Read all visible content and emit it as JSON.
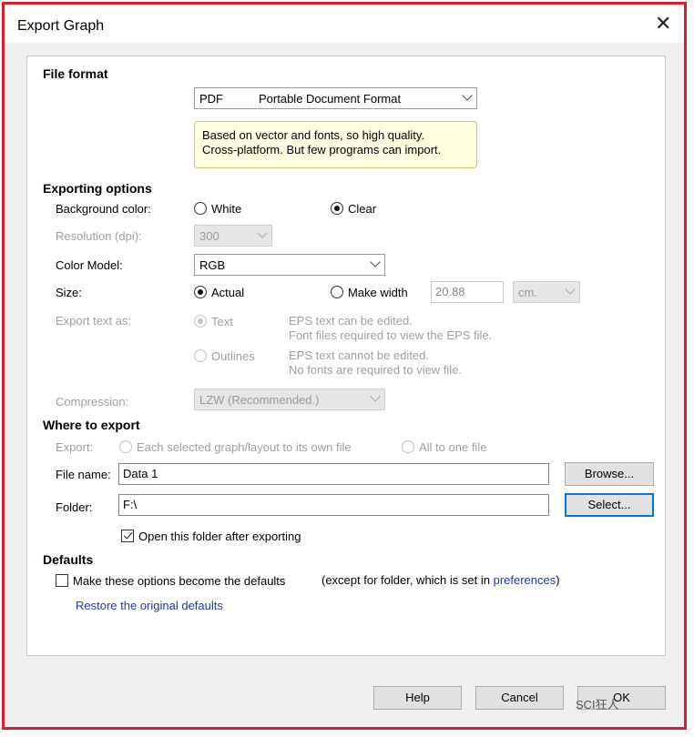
{
  "window": {
    "title": "Export Graph",
    "close_glyph": "✕"
  },
  "file_format": {
    "heading": "File format",
    "format_code": "PDF",
    "format_name": "Portable Document Format",
    "tip_line1": "Based on vector and fonts, so high quality.",
    "tip_line2": "Cross-platform. But few programs can import."
  },
  "exporting_options": {
    "heading": "Exporting options",
    "background_label": "Background color:",
    "bg_white": "White",
    "bg_clear": "Clear",
    "bg_selected": "Clear",
    "resolution_label": "Resolution (dpi):",
    "resolution_value": "300",
    "color_model_label": "Color Model:",
    "color_model_value": "RGB",
    "size_label": "Size:",
    "size_actual": "Actual",
    "size_make_width": "Make width",
    "size_selected": "Actual",
    "width_value": "20.88",
    "unit_value": "cm.",
    "export_text_label": "Export text as:",
    "text_option": "Text",
    "text_desc1": "EPS text can be edited.",
    "text_desc2": "Font files required to view the EPS file.",
    "outlines_option": "Outlines",
    "outlines_desc1": "EPS text cannot be edited.",
    "outlines_desc2": "No fonts are required to view file.",
    "compression_label": "Compression:",
    "compression_value": "LZW (Recommended.)"
  },
  "where_to_export": {
    "heading": "Where to export",
    "export_label": "Export:",
    "each_option": "Each selected graph/layout to its own file",
    "all_option": "All to one file",
    "file_name_label": "File name:",
    "file_name_value": "Data 1",
    "browse_button": "Browse...",
    "folder_label": "Folder:",
    "folder_value": "F:\\",
    "select_button": "Select...",
    "open_folder_label": "Open this folder after exporting",
    "open_folder_checked": true
  },
  "defaults": {
    "heading": "Defaults",
    "make_defaults_label": "Make these options become the defaults",
    "make_defaults_checked": false,
    "except_prefix": "(except for folder, which is set in ",
    "preferences_link": "preferences",
    "except_suffix": ")",
    "restore_link": "Restore the original defaults"
  },
  "footer": {
    "help": "Help",
    "cancel": "Cancel",
    "ok": "OK"
  },
  "watermark": "SCI狂人",
  "colors": {
    "border": "#d9202a",
    "link": "#1a3bb8",
    "tip_bg": "#ffffe1",
    "focus": "#0078d7"
  }
}
